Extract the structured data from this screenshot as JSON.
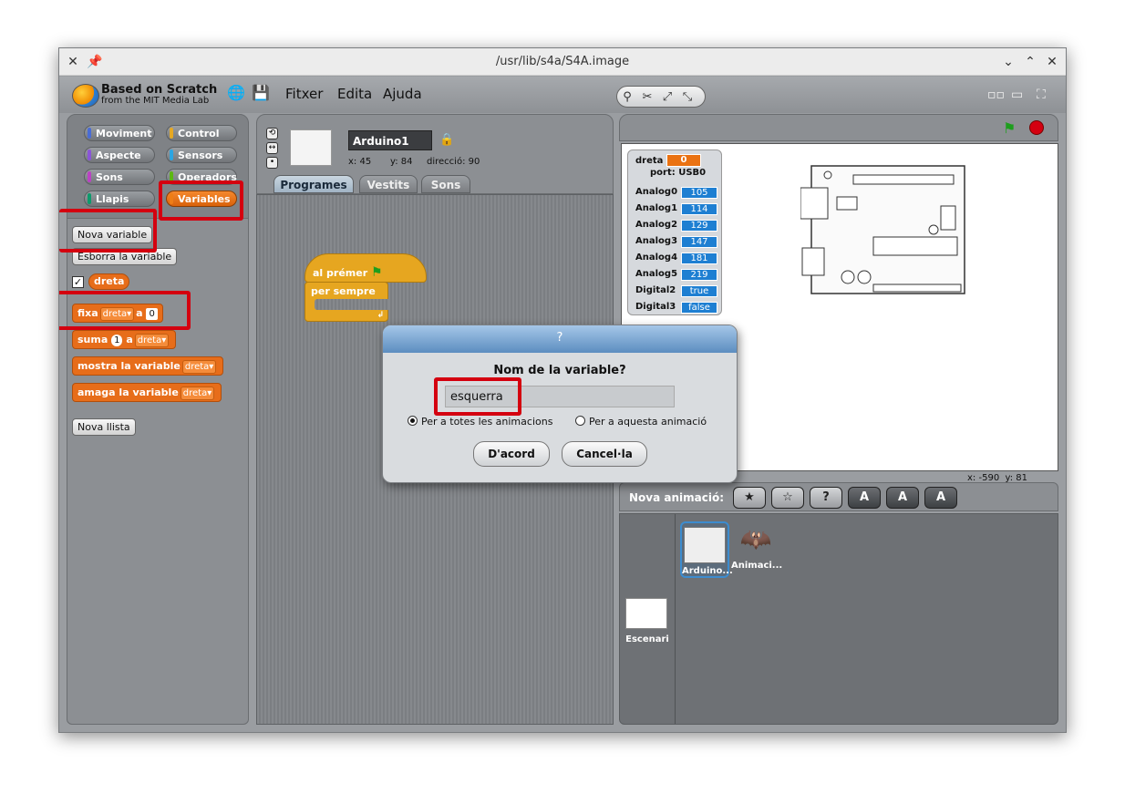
{
  "window": {
    "title": "/usr/lib/s4a/S4A.image"
  },
  "brand": {
    "line1": "Based on Scratch",
    "line2": "from the MIT Media Lab"
  },
  "menu": {
    "file": "Fitxer",
    "edit": "Edita",
    "help": "Ajuda"
  },
  "categories": [
    {
      "label": "Moviment",
      "color": "#4a6cd4"
    },
    {
      "label": "Control",
      "color": "#e6a822"
    },
    {
      "label": "Aspecte",
      "color": "#8a55d7"
    },
    {
      "label": "Sensors",
      "color": "#2ca5e2"
    },
    {
      "label": "Sons",
      "color": "#bb42c3"
    },
    {
      "label": "Operadors",
      "color": "#5cb712"
    },
    {
      "label": "Llapis",
      "color": "#0e9a6c"
    },
    {
      "label": "Variables",
      "color": "#ee7d16"
    }
  ],
  "palette": {
    "new_variable": "Nova variable",
    "delete_variable": "Esborra la variable",
    "variable_name": "dreta",
    "set_block": {
      "label": "fixa",
      "var": "dreta",
      "to": "a",
      "value": "0"
    },
    "change_block": {
      "label": "suma",
      "value": "1",
      "to": "a",
      "var": "dreta"
    },
    "show_block": {
      "label": "mostra la variable",
      "var": "dreta"
    },
    "hide_block": {
      "label": "amaga la variable",
      "var": "dreta"
    },
    "new_list": "Nova llista"
  },
  "sprite": {
    "name": "Arduino1",
    "x_label": "x:",
    "x": "45",
    "y_label": "y:",
    "y": "84",
    "dir_label": "direcció:",
    "direction": "90"
  },
  "tabs": [
    "Programes",
    "Vestits",
    "Sons"
  ],
  "scripts": {
    "hat": "al prémer",
    "forever": "per sempre"
  },
  "monitor": {
    "var_name": "dreta",
    "var_value": "0",
    "port": "port: USB0",
    "rows": [
      {
        "label": "Analog0",
        "value": "105"
      },
      {
        "label": "Analog1",
        "value": "114"
      },
      {
        "label": "Analog2",
        "value": "129"
      },
      {
        "label": "Analog3",
        "value": "147"
      },
      {
        "label": "Analog4",
        "value": "181"
      },
      {
        "label": "Analog5",
        "value": "219"
      },
      {
        "label": "Digital2",
        "value": "true"
      },
      {
        "label": "Digital3",
        "value": "false"
      }
    ]
  },
  "stage_coords": {
    "x_label": "x:",
    "x": "-590",
    "y_label": "y:",
    "y": "81"
  },
  "sprites_panel": {
    "label": "Nova animació:",
    "sprites": [
      "Arduino...",
      "Animaci..."
    ],
    "stage": "Escenari"
  },
  "dialog": {
    "title": "?",
    "question": "Nom de la variable?",
    "value": "esquerra",
    "option_all": "Per a totes les animacions",
    "option_this": "Per a aquesta animació",
    "ok": "D'acord",
    "cancel": "Cancel·la"
  }
}
